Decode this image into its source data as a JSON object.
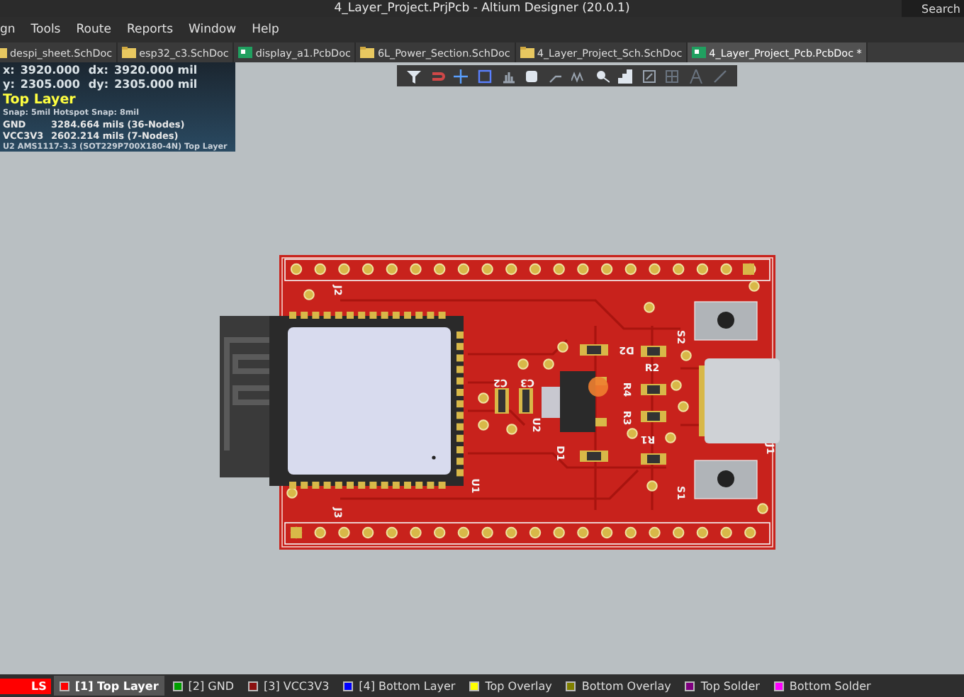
{
  "window": {
    "title": "4_Layer_Project.PrjPcb - Altium Designer (20.0.1)"
  },
  "search": {
    "placeholder": "Search"
  },
  "menu": [
    {
      "label": "gn"
    },
    {
      "label": "Tools"
    },
    {
      "label": "Route"
    },
    {
      "label": "Reports"
    },
    {
      "label": "Window"
    },
    {
      "label": "Help"
    }
  ],
  "document_tabs": [
    {
      "label": "despi_sheet.SchDoc",
      "kind": "schematic",
      "selected": false
    },
    {
      "label": "esp32_c3.SchDoc",
      "kind": "schematic",
      "selected": false
    },
    {
      "label": "display_a1.PcbDoc",
      "kind": "pcb",
      "selected": false
    },
    {
      "label": "6L_Power_Section.SchDoc",
      "kind": "schematic",
      "selected": false
    },
    {
      "label": "4_Layer_Project_Sch.SchDoc",
      "kind": "schematic",
      "selected": false
    },
    {
      "label": "4_Layer_Project_Pcb.PcbDoc *",
      "kind": "pcb",
      "selected": true
    }
  ],
  "info_overlay": [
    {
      "kind": "coords",
      "cells": [
        "x:",
        "3920.000",
        "dx:",
        "3920.000 mil"
      ]
    },
    {
      "kind": "coords",
      "cells": [
        "y:",
        "2305.000",
        "dy:",
        "2305.000 mil"
      ]
    },
    {
      "kind": "layer",
      "text": "Top Layer"
    },
    {
      "kind": "text",
      "text": "Snap: 5mil Hotspot Snap: 8mil"
    },
    {
      "kind": "net",
      "cells": [
        "GND",
        "3284.664 mils (36-Nodes)"
      ]
    },
    {
      "kind": "net",
      "cells": [
        "VCC3V3",
        "2602.214 mils (7-Nodes)"
      ]
    },
    {
      "kind": "text",
      "text": "U2  AMS1117-3.3 (SOT229P700X180-4N)  Top Layer"
    }
  ],
  "pcb": {
    "designators": [
      "J2",
      "J3",
      "U1",
      "U2",
      "C2",
      "C3",
      "D1",
      "D2",
      "R2",
      "R4",
      "R3",
      "R1",
      "S2",
      "S1",
      "J1"
    ]
  },
  "layer_set": {
    "label": "LS"
  },
  "layer_tabs": [
    {
      "label": "[1] Top Layer",
      "color": "#ff0000",
      "selected": true
    },
    {
      "label": "[2] GND",
      "color": "#00a000",
      "selected": false
    },
    {
      "label": "[3] VCC3V3",
      "color": "#8b1010",
      "selected": false
    },
    {
      "label": "[4] Bottom Layer",
      "color": "#0000ff",
      "selected": false
    },
    {
      "label": "Top Overlay",
      "color": "#ffff00",
      "selected": false
    },
    {
      "label": "Bottom Overlay",
      "color": "#808000",
      "selected": false
    },
    {
      "label": "Top Solder",
      "color": "#800080",
      "selected": false
    },
    {
      "label": "Bottom Solder",
      "color": "#ff00ff",
      "selected": false
    }
  ]
}
